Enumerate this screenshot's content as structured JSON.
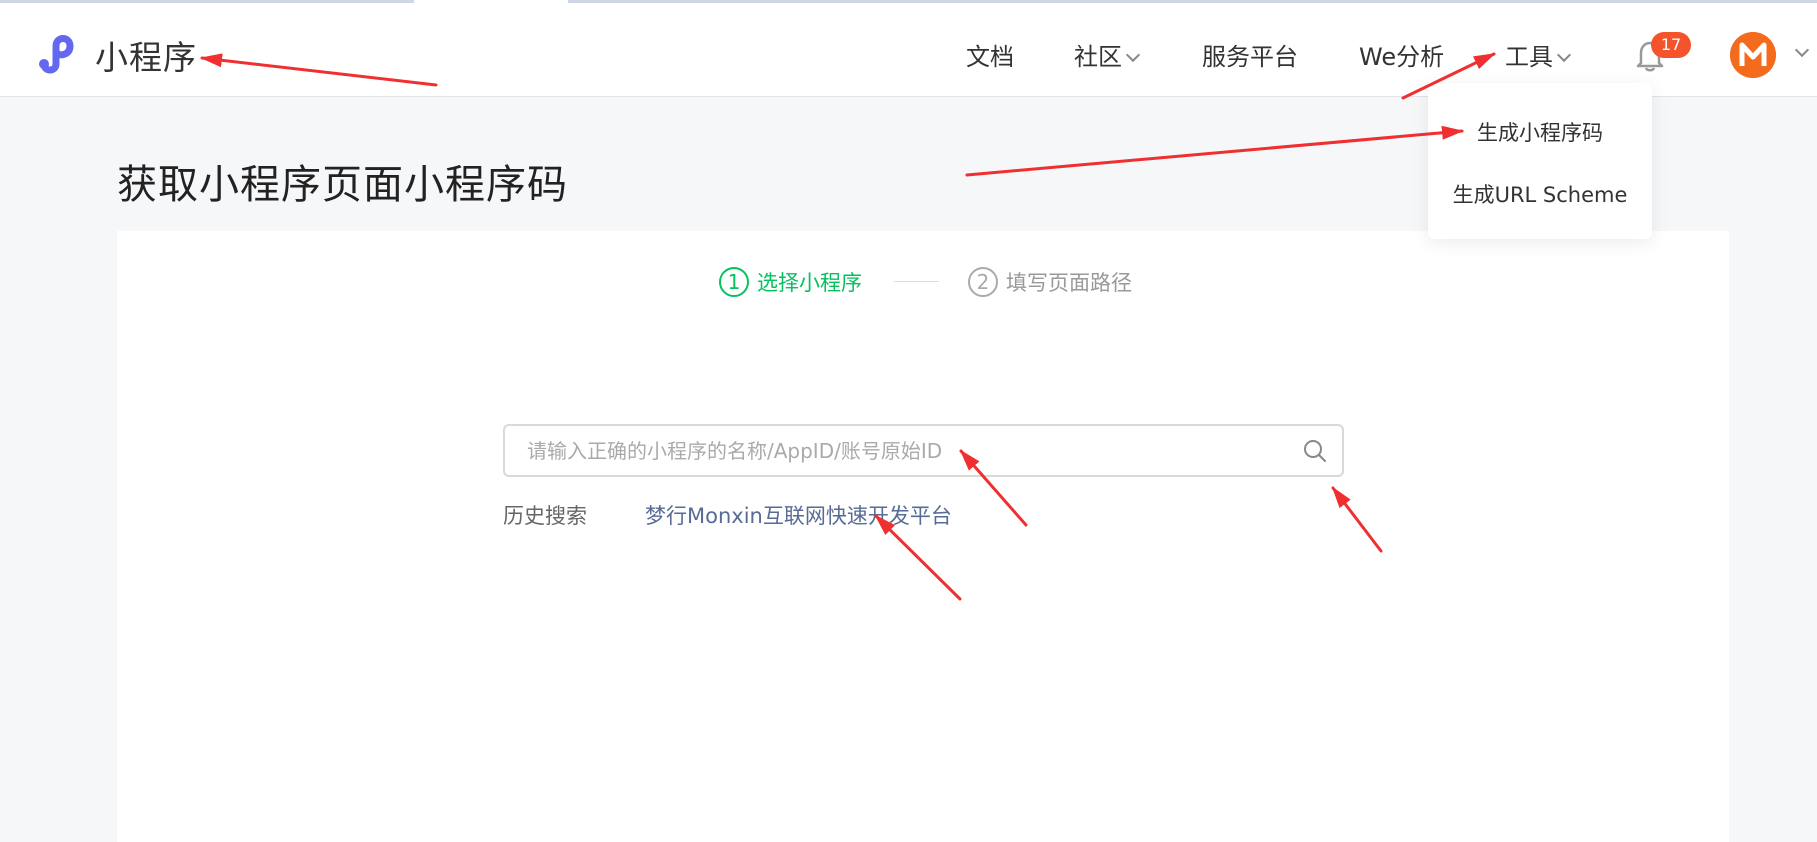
{
  "header": {
    "logo_text": "小程序",
    "nav": {
      "docs": "文档",
      "community": "社区",
      "service_platform": "服务平台",
      "we_analytics": "We分析",
      "tools": "工具"
    },
    "notification_count": "17"
  },
  "tools_menu": {
    "items": [
      "生成小程序码",
      "生成URL Scheme"
    ]
  },
  "page": {
    "title": "获取小程序页面小程序码"
  },
  "steps": [
    {
      "number": "1",
      "label": "选择小程序"
    },
    {
      "number": "2",
      "label": "填写页面路径"
    }
  ],
  "search": {
    "placeholder": "请输入正确的小程序的名称/AppID/账号原始ID",
    "value": ""
  },
  "history": {
    "label": "历史搜索",
    "items": [
      "梦行Monxin互联网快速开发平台"
    ]
  },
  "colors": {
    "brand_green": "#07c160",
    "logo_purple": "#6467f0",
    "badge_red": "#f4532b",
    "avatar_orange": "#f46b1e",
    "link_blue": "#576b95",
    "annotation_red": "#f03030"
  }
}
